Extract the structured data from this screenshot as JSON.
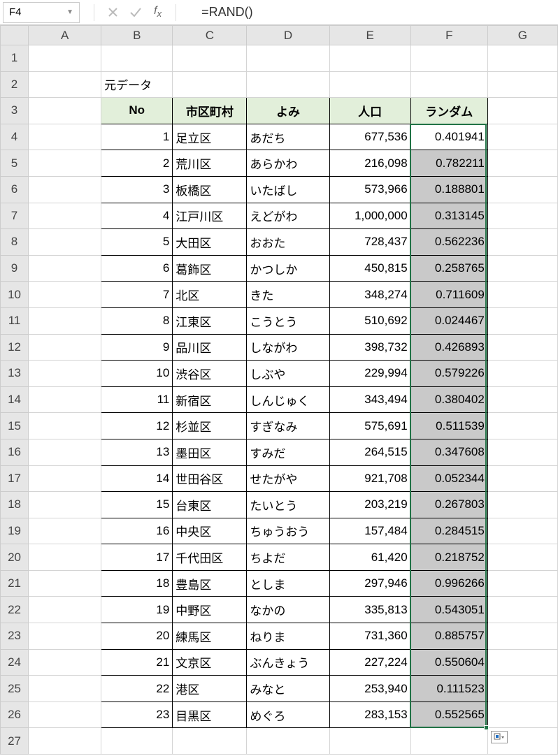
{
  "name_box": "F4",
  "formula": "=RAND()",
  "columns": [
    "A",
    "B",
    "C",
    "D",
    "E",
    "F",
    "G"
  ],
  "row_count": 27,
  "selected_col": "F",
  "selected_rows_start": 4,
  "selected_rows_end": 26,
  "active_cell": "F4",
  "section_label_cell": {
    "row": 2,
    "col": "B",
    "value": "元データ"
  },
  "header_row": 3,
  "headers": {
    "B": "No",
    "C": "市区町村",
    "D": "よみ",
    "E": "人口",
    "F": "ランダム"
  },
  "data_start_row": 4,
  "data": [
    {
      "no": 1,
      "ward": "足立区",
      "yomi": "あだち",
      "pop": "677,536",
      "rand": "0.401941"
    },
    {
      "no": 2,
      "ward": "荒川区",
      "yomi": "あらかわ",
      "pop": "216,098",
      "rand": "0.782211"
    },
    {
      "no": 3,
      "ward": "板橋区",
      "yomi": "いたばし",
      "pop": "573,966",
      "rand": "0.188801"
    },
    {
      "no": 4,
      "ward": "江戸川区",
      "yomi": "えどがわ",
      "pop": "1,000,000",
      "rand": "0.313145"
    },
    {
      "no": 5,
      "ward": "大田区",
      "yomi": "おおた",
      "pop": "728,437",
      "rand": "0.562236"
    },
    {
      "no": 6,
      "ward": "葛飾区",
      "yomi": "かつしか",
      "pop": "450,815",
      "rand": "0.258765"
    },
    {
      "no": 7,
      "ward": "北区",
      "yomi": "きた",
      "pop": "348,274",
      "rand": "0.711609"
    },
    {
      "no": 8,
      "ward": "江東区",
      "yomi": "こうとう",
      "pop": "510,692",
      "rand": "0.024467"
    },
    {
      "no": 9,
      "ward": "品川区",
      "yomi": "しながわ",
      "pop": "398,732",
      "rand": "0.426893"
    },
    {
      "no": 10,
      "ward": "渋谷区",
      "yomi": "しぶや",
      "pop": "229,994",
      "rand": "0.579226"
    },
    {
      "no": 11,
      "ward": "新宿区",
      "yomi": "しんじゅく",
      "pop": "343,494",
      "rand": "0.380402"
    },
    {
      "no": 12,
      "ward": "杉並区",
      "yomi": "すぎなみ",
      "pop": "575,691",
      "rand": "0.511539"
    },
    {
      "no": 13,
      "ward": "墨田区",
      "yomi": "すみだ",
      "pop": "264,515",
      "rand": "0.347608"
    },
    {
      "no": 14,
      "ward": "世田谷区",
      "yomi": "せたがや",
      "pop": "921,708",
      "rand": "0.052344"
    },
    {
      "no": 15,
      "ward": "台東区",
      "yomi": "たいとう",
      "pop": "203,219",
      "rand": "0.267803"
    },
    {
      "no": 16,
      "ward": "中央区",
      "yomi": "ちゅうおう",
      "pop": "157,484",
      "rand": "0.284515"
    },
    {
      "no": 17,
      "ward": "千代田区",
      "yomi": "ちよだ",
      "pop": "61,420",
      "rand": "0.218752"
    },
    {
      "no": 18,
      "ward": "豊島区",
      "yomi": "としま",
      "pop": "297,946",
      "rand": "0.996266"
    },
    {
      "no": 19,
      "ward": "中野区",
      "yomi": "なかの",
      "pop": "335,813",
      "rand": "0.543051"
    },
    {
      "no": 20,
      "ward": "練馬区",
      "yomi": "ねりま",
      "pop": "731,360",
      "rand": "0.885757"
    },
    {
      "no": 21,
      "ward": "文京区",
      "yomi": "ぶんきょう",
      "pop": "227,224",
      "rand": "0.550604"
    },
    {
      "no": 22,
      "ward": "港区",
      "yomi": "みなと",
      "pop": "253,940",
      "rand": "0.111523"
    },
    {
      "no": 23,
      "ward": "目黒区",
      "yomi": "めぐろ",
      "pop": "283,153",
      "rand": "0.552565"
    }
  ]
}
